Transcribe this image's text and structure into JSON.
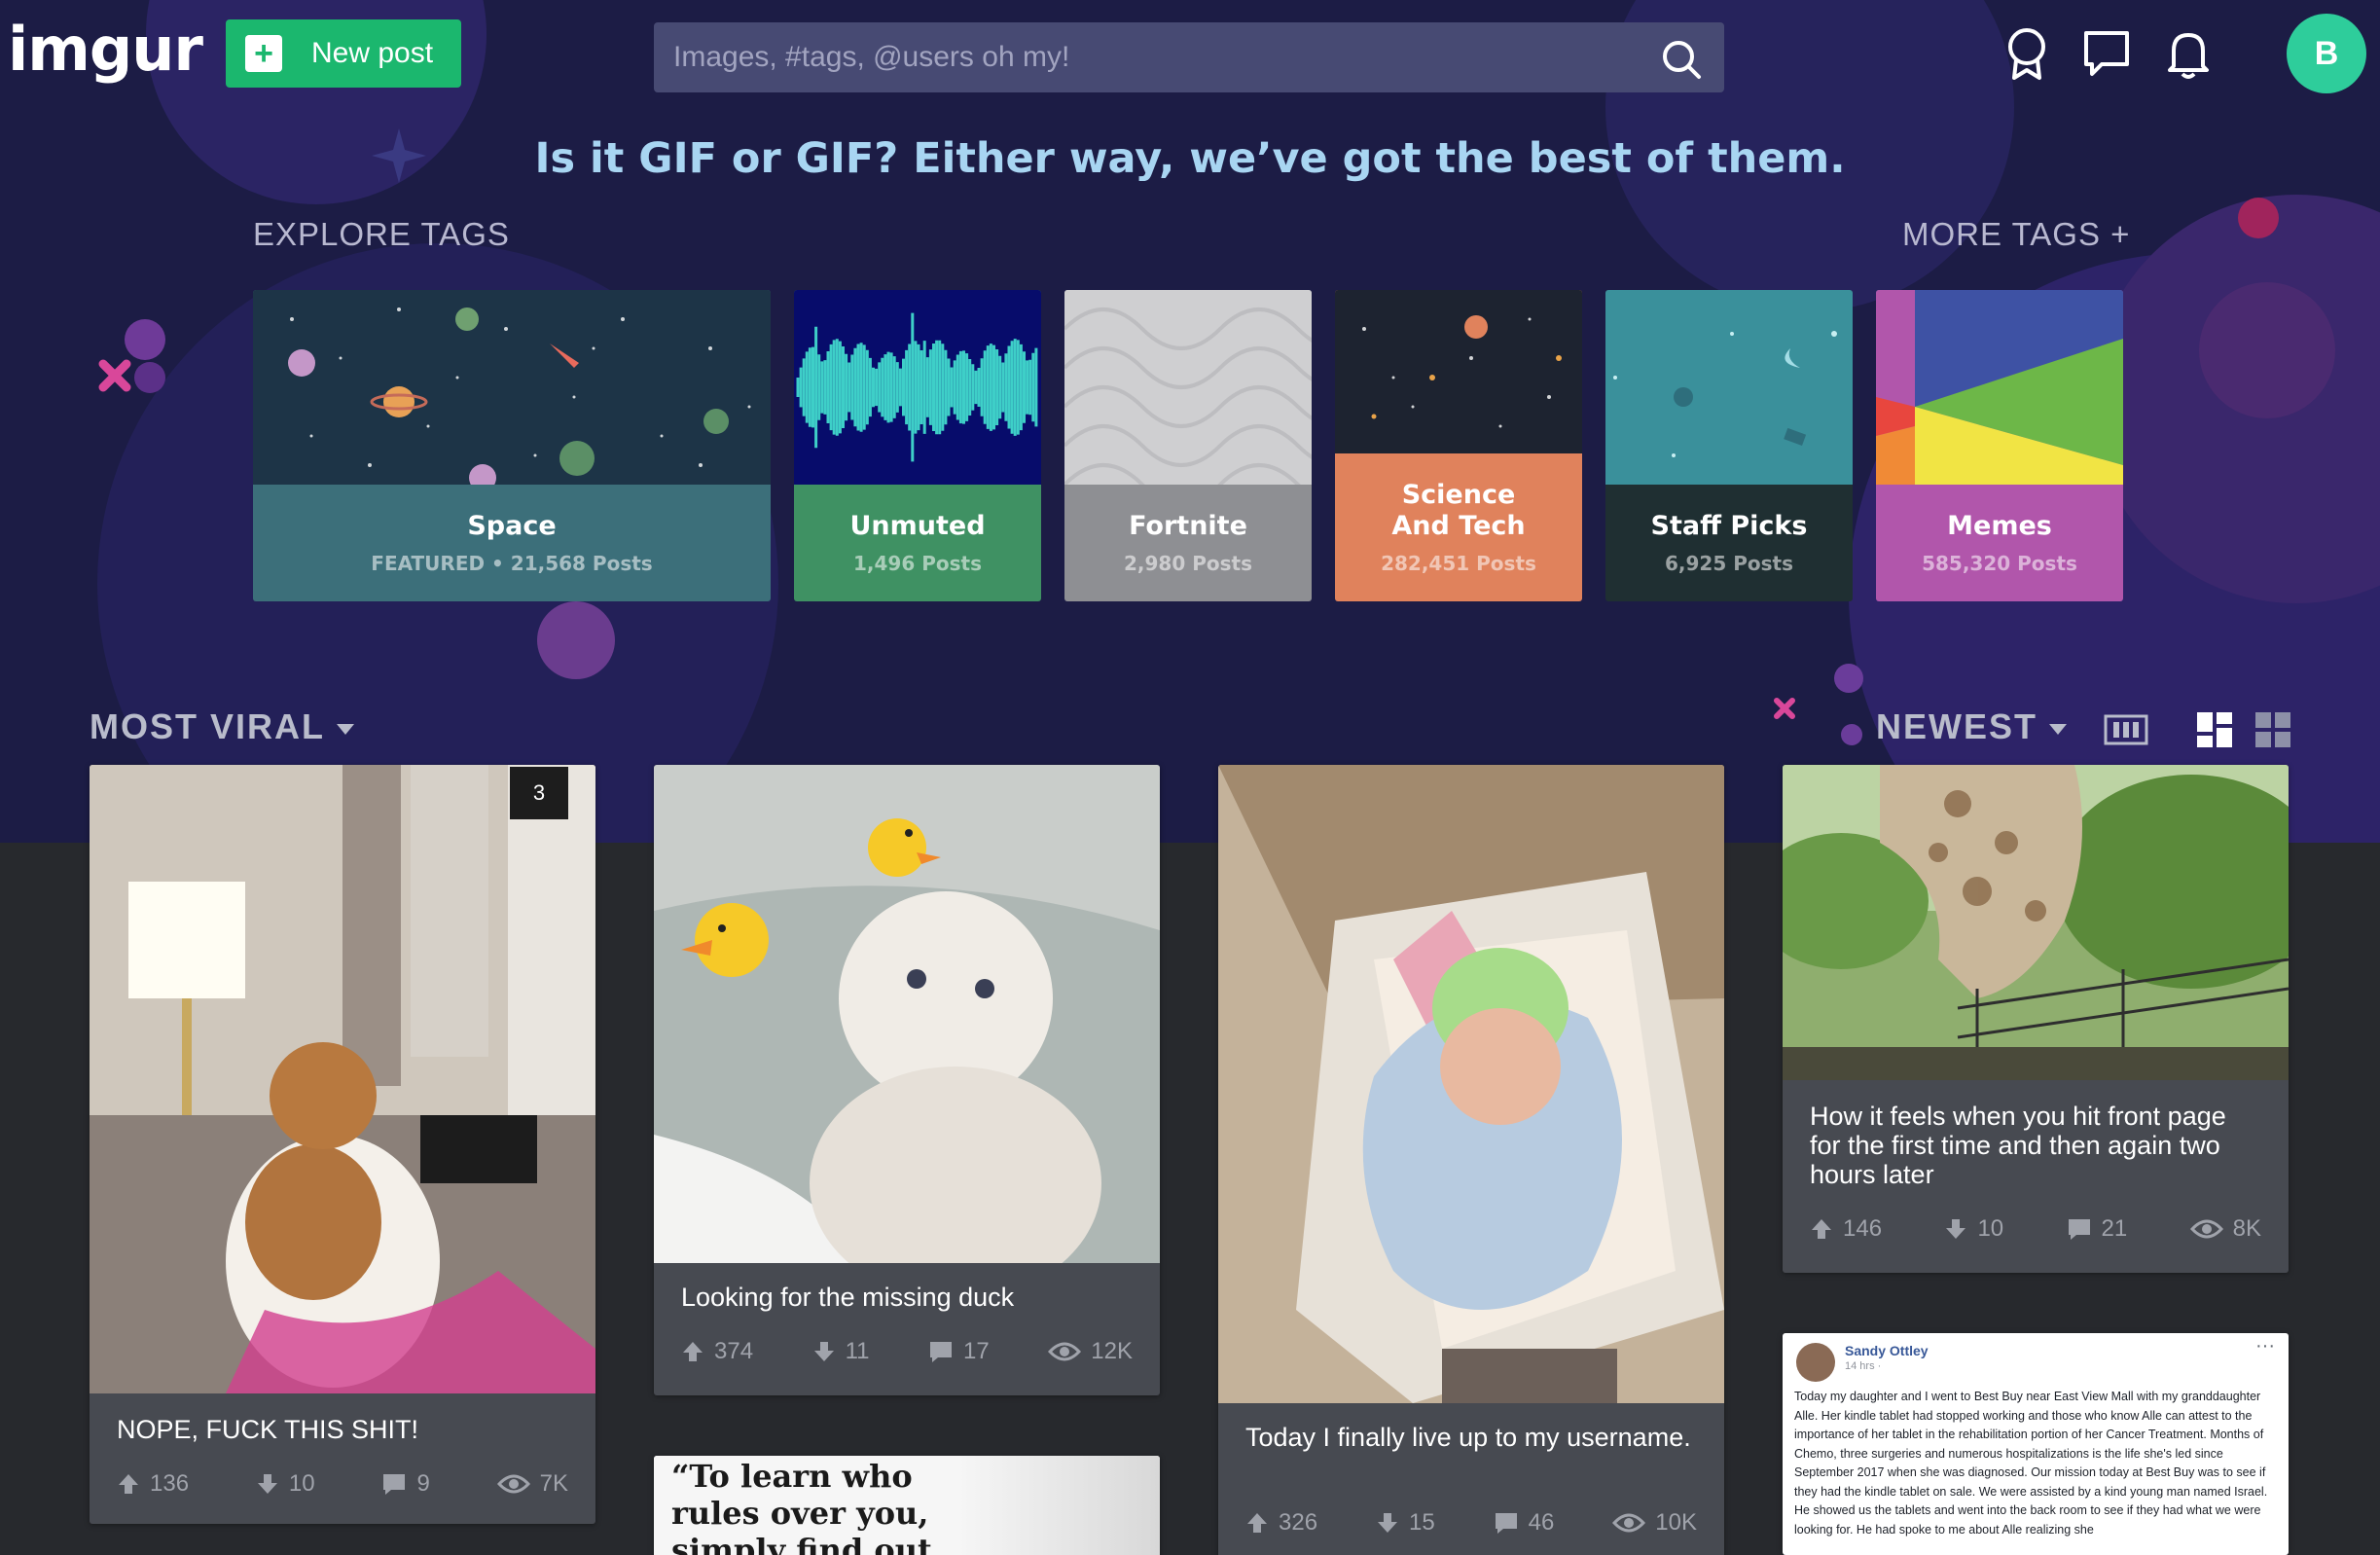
{
  "header": {
    "logo": "imgur",
    "new_post_label": "New post",
    "search_placeholder": "Images, #tags, @users oh my!",
    "avatar_letter": "B"
  },
  "hero": {
    "headline": "Is it GIF or GIF? Either way, we’ve got the best of them.",
    "explore_label": "EXPLORE TAGS",
    "more_tags_label": "MORE TAGS +"
  },
  "tags": [
    {
      "name": "Space",
      "count": "FEATURED • 21,568 Posts",
      "color": "#3c6f7a"
    },
    {
      "name": "Unmuted",
      "count": "1,496 Posts",
      "color": "#3f9163"
    },
    {
      "name": "Fortnite",
      "count": "2,980 Posts",
      "color": "#8e8f93"
    },
    {
      "name": "Science And Tech",
      "count": "282,451 Posts",
      "color": "#e0825c"
    },
    {
      "name": "Staff Picks",
      "count": "6,925 Posts",
      "color": "#1f2f32"
    },
    {
      "name": "Memes",
      "count": "585,320 Posts",
      "color": "#b156ab"
    }
  ],
  "feed": {
    "sort_label": "MOST VIRAL",
    "order_label": "NEWEST"
  },
  "posts": [
    {
      "title": "NOPE, FUCK THIS SHIT!",
      "badge": "3",
      "up": "136",
      "down": "10",
      "comments": "9",
      "views": "7K"
    },
    {
      "title": "Looking for the missing duck",
      "up": "374",
      "down": "11",
      "comments": "17",
      "views": "12K"
    },
    {
      "title": "Today I finally live up to my username.",
      "up": "326",
      "down": "15",
      "comments": "46",
      "views": "10K"
    },
    {
      "title": "How it feels when you hit front page for the first time and then again two hours later",
      "up": "146",
      "down": "10",
      "comments": "21",
      "views": "8K"
    },
    {
      "quote": "“To learn who rules over you, simply find out"
    },
    {
      "fb_name": "Sandy Ottley",
      "fb_time": "14 hrs ·",
      "fb_text": "Today my daughter and I went to Best Buy near East View Mall with my granddaughter Alle. Her kindle tablet had stopped working and those who know Alle can attest to the importance of her tablet in the rehabilitation portion of her Cancer Treatment. Months of Chemo, three surgeries and numerous hospitalizations is the life she's led since September 2017 when she was diagnosed. Our mission today at Best Buy was to see if they had the kindle tablet on sale. We were assisted by a kind young man named Israel. He showed us the tablets and went into the back room to see if they had what we were looking for. He had spoke to me about Alle realizing she"
    }
  ]
}
